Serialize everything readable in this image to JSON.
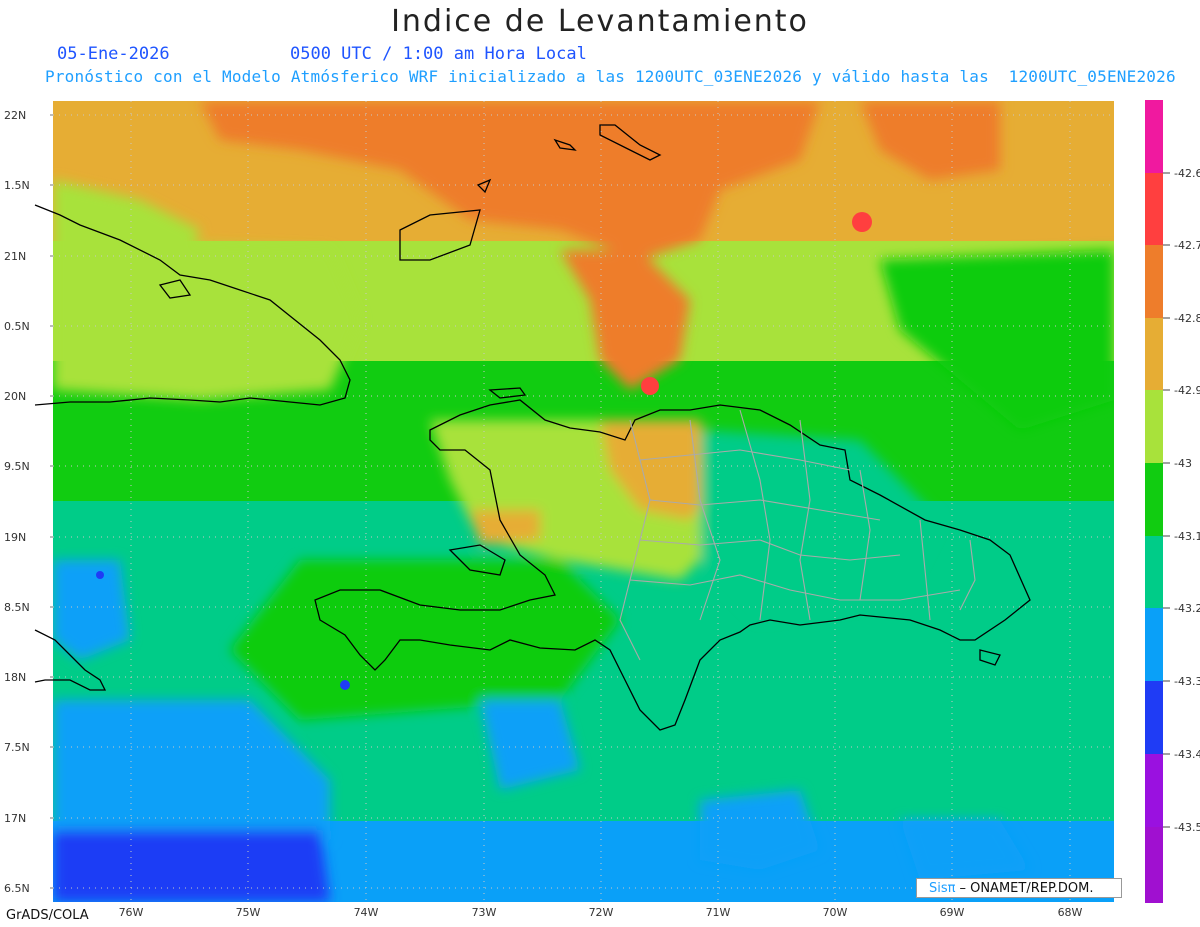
{
  "title": "Indice de Levantamiento",
  "date": "05-Ene-2026",
  "time": "0500 UTC / 1:00 am Hora Local",
  "subtitle": "Pronóstico con el Modelo Atmósferico WRF inicializado a las 1200UTC_03ENE2026 y válido hasta las  1200UTC_05ENE2026",
  "y_ticks": [
    "22N",
    "1.5N",
    "21N",
    "0.5N",
    "20N",
    "9.5N",
    "19N",
    "8.5N",
    "18N",
    "7.5N",
    "17N",
    "6.5N"
  ],
  "x_ticks": [
    "76W",
    "75W",
    "74W",
    "73W",
    "72W",
    "71W",
    "70W",
    "69W",
    "68W"
  ],
  "legend": [
    "-42.6",
    "-42.7",
    "-42.8",
    "-42.9",
    "-43",
    "-43.1",
    "-43.2",
    "-43.3",
    "-43.4",
    "-43.5"
  ],
  "legend_colors": [
    "#f0199f",
    "#ff3f3f",
    "#ee7d2b",
    "#e6ad34",
    "#a8e23b",
    "#11cc11",
    "#00cc88",
    "#0aa0f8",
    "#1f3cf5",
    "#9a11e0",
    "#a010d0"
  ],
  "footer": "GrADS/COLA",
  "credit_sis": "Sisπ",
  "credit_org": "– ONAMET/REP.DOM."
}
